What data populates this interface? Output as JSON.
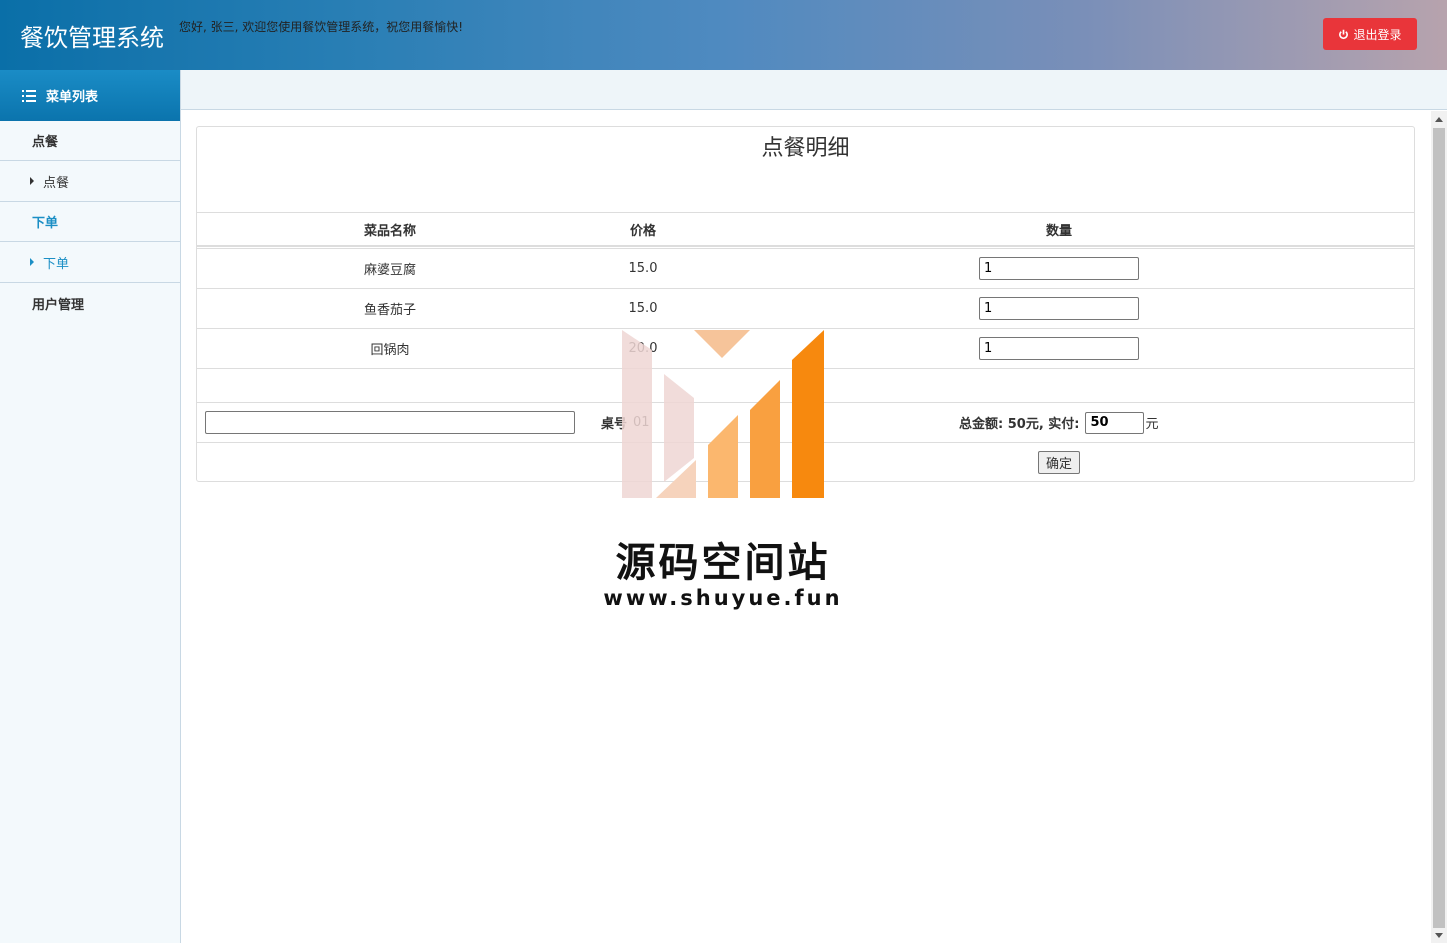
{
  "header": {
    "app_title": "餐饮管理系统",
    "welcome": "您好, 张三, 欢迎您使用餐饮管理系统，祝您用餐愉快!",
    "logout_label": "退出登录"
  },
  "sidebar": {
    "heading": "菜单列表",
    "groups": [
      {
        "label": "点餐",
        "sub": "点餐"
      },
      {
        "label": "下单",
        "sub": "下单"
      },
      {
        "label": "用户管理"
      }
    ]
  },
  "panel": {
    "title": "点餐明细",
    "columns": [
      "菜品名称",
      "价格",
      "数量"
    ],
    "rows": [
      {
        "name": "麻婆豆腐",
        "price": "15.0",
        "qty": "1"
      },
      {
        "name": "鱼香茄子",
        "price": "15.0",
        "qty": "1"
      },
      {
        "name": "回锅肉",
        "price": "20.0",
        "qty": "1"
      }
    ],
    "table_label": "桌号",
    "table_value": "01",
    "total_text": "总金额: 50元,  实付:",
    "paid_value": "50",
    "currency_unit": "元",
    "confirm_label": "确定"
  },
  "watermark": {
    "text": "源码空间站",
    "url": "www.shuyue.fun"
  },
  "colors": {
    "logout": "#e9353a",
    "accent": "#1b8fc5"
  }
}
